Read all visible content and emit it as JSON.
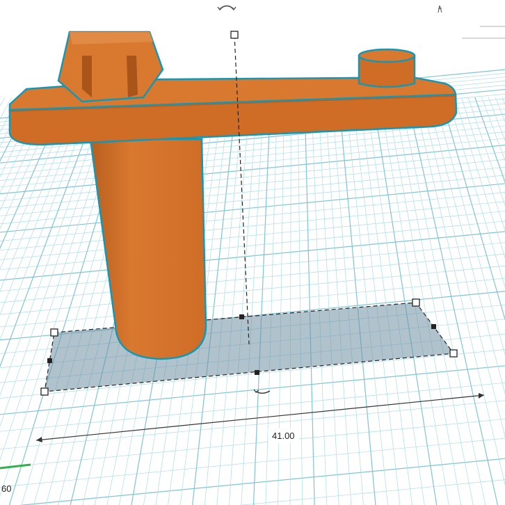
{
  "viewport": {
    "grid_color": "#a9dce8",
    "grid_major_color": "#7fc4d6",
    "background_color": "#ffffff"
  },
  "object": {
    "fill_color": "#d9782f",
    "fill_dark": "#b85f1f",
    "outline_color": "#1597b4",
    "shadow_color": "#6f8fa3"
  },
  "dimensions": {
    "width_value": "41.00",
    "depth_value": "60"
  },
  "gizmo": {
    "rotate_top_icon": "rotate-arrow-icon",
    "rotate_bottom_icon": "rotate-arrow-icon",
    "corner_icon": "cursor-glyph-icon"
  }
}
